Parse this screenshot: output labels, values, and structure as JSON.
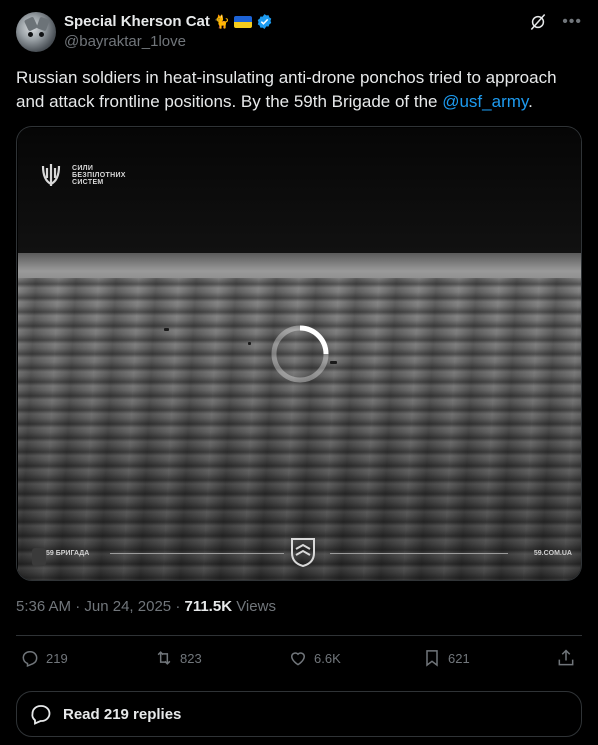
{
  "author": {
    "display_name": "Special Kherson Cat",
    "emoji": "🐈",
    "handle": "@bayraktar_1love",
    "verified": true
  },
  "icons": {
    "grok": "grok-icon",
    "more": "more-icon",
    "reply": "reply-icon",
    "retweet": "retweet-icon",
    "like": "heart-icon",
    "bookmark": "bookmark-icon",
    "share": "share-icon",
    "replies": "speech-bubble-icon"
  },
  "tweet": {
    "text": "Russian soldiers in heat-insulating anti-drone ponchos tried to approach and attack frontline positions. By the 59th Brigade of the ",
    "mention": "@usf_army",
    "text_end": "."
  },
  "media": {
    "logo_line1": "СИЛИ",
    "logo_line2": "БЕЗПІЛОТНИХ",
    "logo_line3": "СИСТЕМ",
    "brigade_label": "59 БРИГАДА",
    "site_label": "59.COM.UA",
    "loading": true
  },
  "meta": {
    "time": "5:36 AM",
    "date": "Jun 24, 2025",
    "separator": "·",
    "views_count": "711.5K",
    "views_label": "Views"
  },
  "actions": {
    "replies": "219",
    "reposts": "823",
    "likes": "6.6K",
    "bookmarks": "621"
  },
  "read_replies": "Read 219 replies",
  "colors": {
    "background": "#000000",
    "text": "#e7e9ea",
    "secondary": "#71767b",
    "link": "#1d9bf0",
    "border": "#2f3336",
    "verified": "#1d9bf0"
  }
}
